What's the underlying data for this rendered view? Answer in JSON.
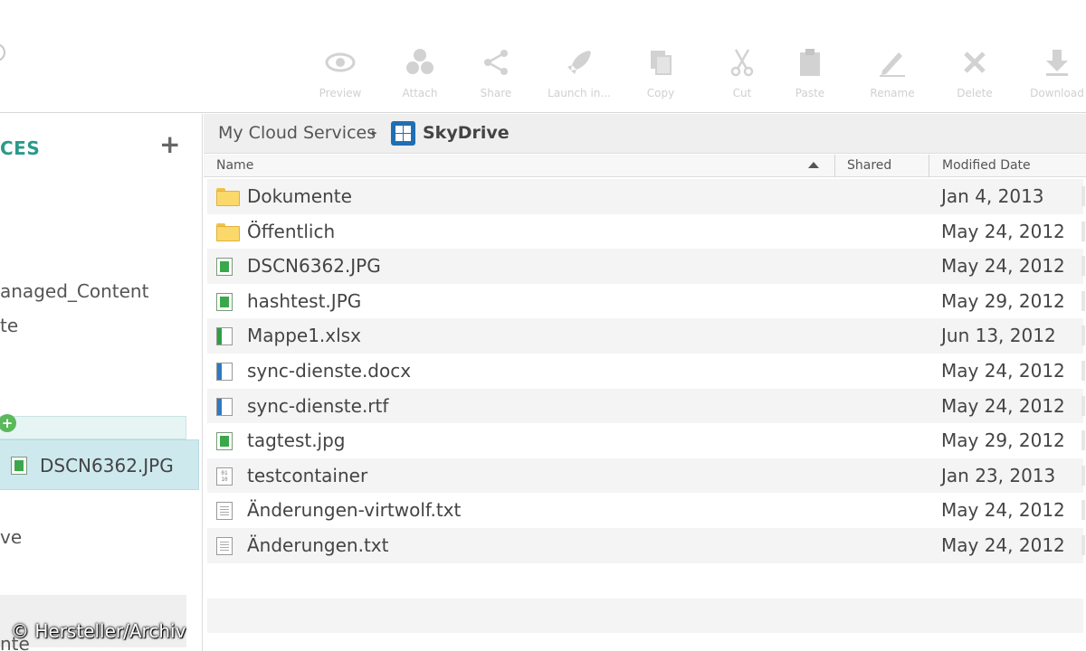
{
  "toolbar": {
    "buttons": [
      {
        "label": "Preview",
        "icon": "eye-icon"
      },
      {
        "label": "Attach",
        "icon": "attach-icon"
      },
      {
        "label": "Share",
        "icon": "share-icon"
      },
      {
        "label": "Launch in...",
        "icon": "rocket-icon"
      },
      {
        "label": "Copy",
        "icon": "copy-icon"
      },
      {
        "label": "Cut",
        "icon": "scissors-icon"
      },
      {
        "label": "Paste",
        "icon": "clipboard-icon"
      },
      {
        "label": "Rename",
        "icon": "pencil-icon"
      },
      {
        "label": "Delete",
        "icon": "x-icon"
      },
      {
        "label": "Download",
        "icon": "download-icon"
      }
    ]
  },
  "sidebar": {
    "header": "CES",
    "add_label": "+",
    "items": [
      {
        "label": "anaged_Content"
      },
      {
        "label": "te"
      },
      {
        "label": "ve"
      },
      {
        "label": "nte"
      }
    ],
    "selected_item": {
      "label": "DSCN6362.JPG",
      "icon": "image-file-icon"
    },
    "credit": "© Hersteller/Archiv"
  },
  "breadcrumb": {
    "root": "My Cloud Services",
    "separator": "▸",
    "current": "SkyDrive",
    "current_icon": "windows-logo-icon"
  },
  "columns": {
    "name": "Name",
    "shared": "Shared",
    "modified": "Modified Date"
  },
  "files": [
    {
      "name": "Dokumente",
      "type": "folder",
      "date": "Jan 4, 2013"
    },
    {
      "name": "Öffentlich",
      "type": "folder",
      "date": "May 24, 2012"
    },
    {
      "name": "DSCN6362.JPG",
      "type": "image",
      "date": "May 24, 2012"
    },
    {
      "name": "hashtest.JPG",
      "type": "image",
      "date": "May 29, 2012"
    },
    {
      "name": "Mappe1.xlsx",
      "type": "spreadsheet",
      "date": "Jun 13, 2012"
    },
    {
      "name": "sync-dienste.docx",
      "type": "document",
      "date": "May 24, 2012"
    },
    {
      "name": "sync-dienste.rtf",
      "type": "document",
      "date": "May 24, 2012"
    },
    {
      "name": "tagtest.jpg",
      "type": "image",
      "date": "May 29, 2012"
    },
    {
      "name": "testcontainer",
      "type": "binary",
      "date": "Jan 23, 2013"
    },
    {
      "name": "Änderungen-virtwolf.txt",
      "type": "text",
      "date": "May 24, 2012"
    },
    {
      "name": "Änderungen.txt",
      "type": "text",
      "date": "May 24, 2012"
    }
  ]
}
